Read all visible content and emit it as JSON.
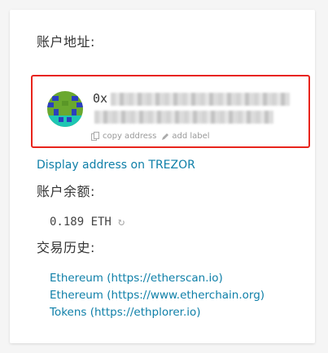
{
  "account": {
    "address_label": "账户地址:",
    "address_prefix": "0x",
    "copy_label": "copy address",
    "add_label": "add label",
    "display_on_trezor": "Display address on TREZOR",
    "balance_label": "账户余额:",
    "balance_value": "0.189 ETH",
    "history_label": "交易历史:",
    "history_links": [
      "Ethereum (https://etherscan.io)",
      "Ethereum (https://www.etherchain.org)",
      "Tokens (https://ethplorer.io)"
    ]
  },
  "colors": {
    "highlight_border": "#e8241c",
    "link": "#0e7fa8",
    "identicon_green": "#6aa82f",
    "identicon_blue": "#2a3fbf",
    "identicon_teal": "#1ec6b3"
  },
  "icons": {
    "copy": "copy-icon",
    "label": "pencil-icon",
    "refresh": "refresh-icon"
  }
}
